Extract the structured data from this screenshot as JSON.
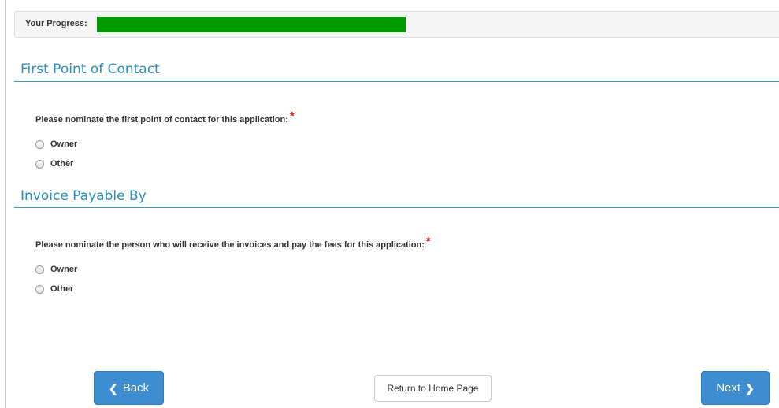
{
  "progress": {
    "label": "Your Progress:",
    "value_fraction": 0.44,
    "fill_color": "#009900"
  },
  "sections": [
    {
      "title": "First Point of Contact",
      "question": "Please nominate the first point of contact for this application:",
      "required_marker": "*",
      "options": [
        "Owner",
        "Other"
      ]
    },
    {
      "title": "Invoice Payable By",
      "question": "Please nominate the person who will receive the invoices and pay the fees for this application:",
      "required_marker": "*",
      "options": [
        "Owner",
        "Other"
      ]
    }
  ],
  "buttons": {
    "back_label": "Back",
    "back_icon": "chevron-left-icon",
    "home_label": "Return to Home Page",
    "next_label": "Next",
    "next_icon": "chevron-right-icon"
  },
  "colors": {
    "accent": "#2a8ec0",
    "primary_button": "#3d8ed0",
    "required": "#e21a1a"
  }
}
